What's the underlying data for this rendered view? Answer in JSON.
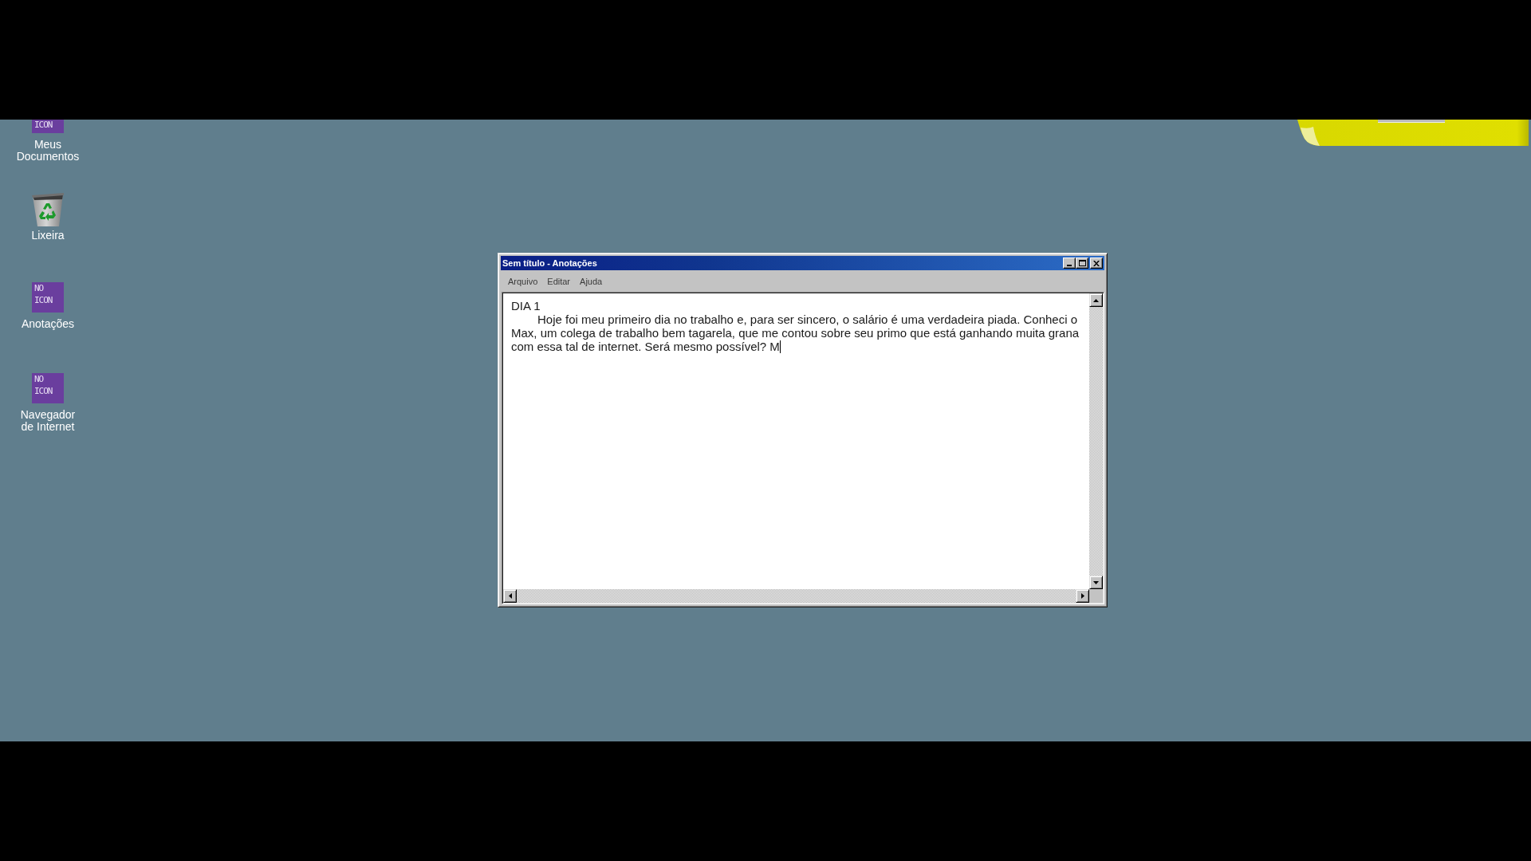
{
  "desktop": {
    "icons": [
      {
        "kind": "placeholder",
        "tile_text": "ICON",
        "label": "Meus Documentos"
      },
      {
        "kind": "recycle_bin",
        "label": "Lixeira"
      },
      {
        "kind": "placeholder",
        "tile_text": "NO ICON",
        "label": "Anotações"
      },
      {
        "kind": "placeholder",
        "tile_text": "NO ICON",
        "label": "Navegador de Internet"
      }
    ]
  },
  "window": {
    "title": "Sem título - Anotações",
    "controls": [
      {
        "kind": "minimize"
      },
      {
        "kind": "maximize"
      },
      {
        "kind": "close"
      }
    ],
    "menu": [
      "Arquivo",
      "Editar",
      "Ajuda"
    ],
    "editor": {
      "focused": true,
      "lines": [
        {
          "text": "DIA 1",
          "indented": false
        },
        {
          "text": "Hoje foi meu primeiro dia no trabalho e, para ser sincero, o salário é uma verdadeira piada. Conheci o Max, um colega de trabalho bem tagarela, que me contou sobre seu primo que está ganhando muita grana com essa tal de internet. Será mesmo possível? M",
          "indented": true
        }
      ]
    }
  }
}
